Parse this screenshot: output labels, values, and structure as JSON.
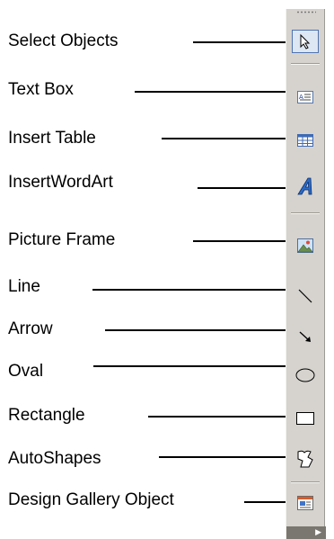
{
  "labels": {
    "select_objects": "Select Objects",
    "text_box": "Text Box",
    "insert_table": "Insert Table",
    "insert_word_art": "InsertWordArt",
    "picture_frame": "Picture Frame",
    "line": "Line",
    "arrow": "Arrow",
    "oval": "Oval",
    "rectangle": "Rectangle",
    "auto_shapes": "AutoShapes",
    "design_gallery_object": "Design Gallery Object"
  },
  "toolbar": {
    "icons": [
      "select-pointer-icon",
      "text-box-icon",
      "insert-table-icon",
      "wordart-icon",
      "picture-frame-icon",
      "line-icon",
      "arrow-icon",
      "oval-icon",
      "rectangle-icon",
      "autoshapes-icon",
      "design-gallery-icon"
    ],
    "background": "#d6d3ce",
    "active_color": "#4f74b0"
  }
}
